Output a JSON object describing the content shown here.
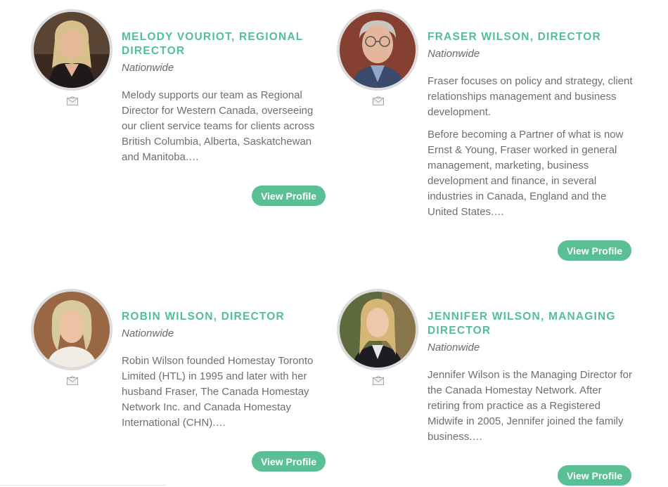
{
  "colors": {
    "accent": "#52bf96",
    "button": "#5bbf95",
    "text": "#6f6f6f"
  },
  "people": [
    {
      "name": "MELODY VOURIOT, REGIONAL DIRECTOR",
      "location": "Nationwide",
      "bio": [
        "Melody supports our team as Regional Director for Western Canada, overseeing our client service teams for clients across British Columbia, Alberta, Saskatchewan and Manitoba.…"
      ],
      "button": "View Profile",
      "icon": "mail-icon"
    },
    {
      "name": "FRASER WILSON, DIRECTOR",
      "location": "Nationwide",
      "bio": [
        "Fraser focuses on policy and strategy, client relationships management and business development.",
        "Before becoming a Partner of what is now Ernst & Young, Fraser worked in general management, marketing, business development and finance, in several industries in Canada, England and the United States.…"
      ],
      "button": "View Profile",
      "icon": "mail-icon"
    },
    {
      "name": "ROBIN WILSON, DIRECTOR",
      "location": "Nationwide",
      "bio": [
        "Robin Wilson founded Homestay Toronto Limited (HTL) in 1995 and later with her husband Fraser, The Canada Homestay Network Inc. and Canada Homestay International (CHN).…"
      ],
      "button": "View Profile",
      "icon": "mail-icon"
    },
    {
      "name": "JENNIFER WILSON, MANAGING DIRECTOR",
      "location": "Nationwide",
      "bio": [
        "Jennifer Wilson is the Managing Director for the Canada Homestay Network. After retiring from practice as a Registered Midwife in 2005, Jennifer joined the family business.…"
      ],
      "button": "View Profile",
      "icon": "mail-icon"
    }
  ]
}
